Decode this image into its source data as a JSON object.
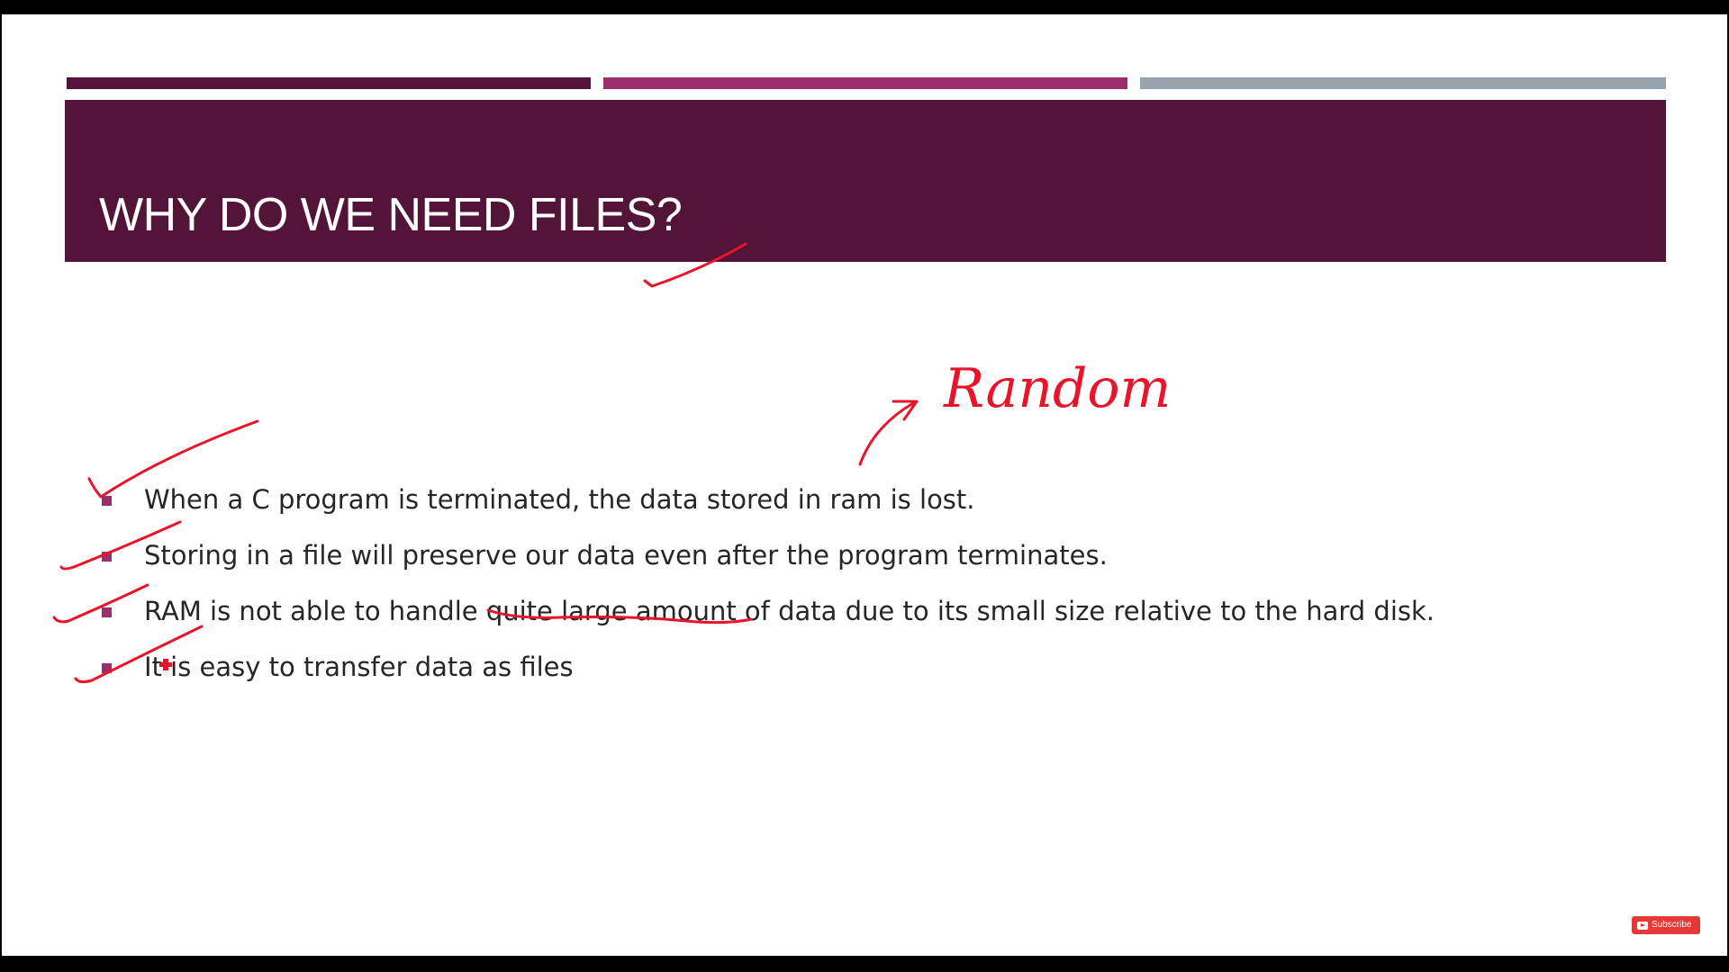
{
  "slide": {
    "title": "WHY DO WE NEED FILES?",
    "colors": {
      "title_band": "#521537",
      "accent_1": "#521537",
      "accent_2": "#9b2f6e",
      "accent_3": "#98a2ab",
      "bullet_marker": "#9b2f6e",
      "text": "#262626",
      "annotation_ink": "#e8142a"
    },
    "bullets": [
      {
        "text": "When a  C program is terminated, the data stored in ram is lost."
      },
      {
        "text": "Storing in a file will preserve our data even after  the program terminates."
      },
      {
        "text": "RAM is not able to handle quite large amount of data due to its small size relative to the hard disk."
      },
      {
        "text": "It is easy to transfer data as files"
      }
    ]
  },
  "annotations": {
    "handwritten_note": "Random",
    "marks": [
      "check-mark",
      "check-mark",
      "check-mark",
      "check-mark",
      "check-mark",
      "underline",
      "arrow",
      "pen-cursor"
    ]
  },
  "overlay": {
    "subscribe_label": "Subscribe",
    "icon": "youtube-play-icon"
  }
}
